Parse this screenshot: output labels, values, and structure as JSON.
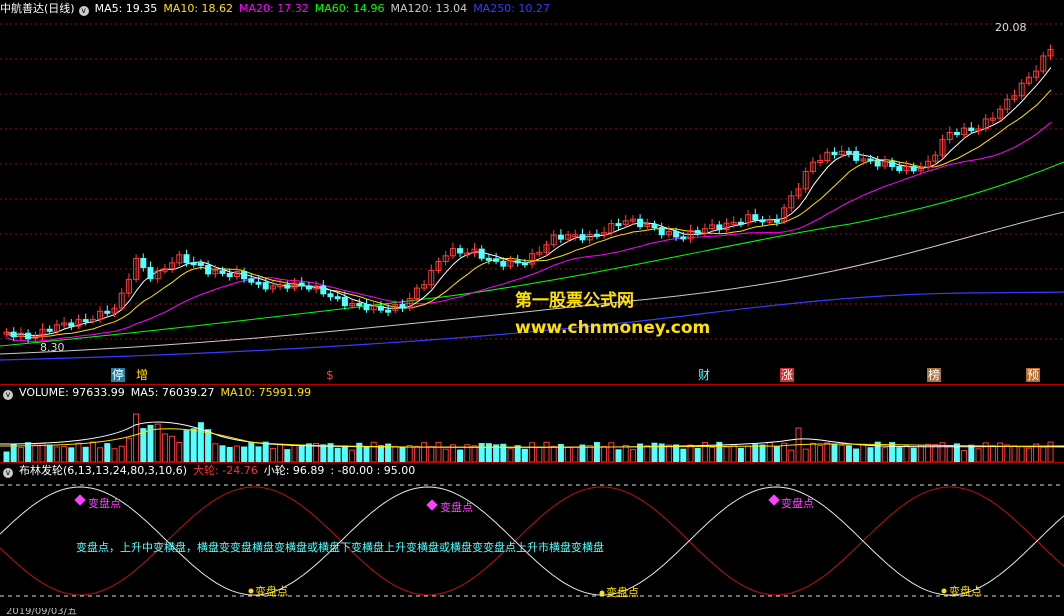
{
  "price_header": {
    "stock": "中航善达(日线)",
    "ma5": "MA5: 19.35",
    "ma10": "MA10: 18.62",
    "ma20": "MA20: 17.32",
    "ma60": "MA60: 14.96",
    "ma120": "MA120: 13.04",
    "ma250": "MA250: 10.27"
  },
  "price_labels": {
    "high": "20.08",
    "low": "8.30"
  },
  "events": [
    "停",
    "增",
    "$",
    "财",
    "涨",
    "榜",
    "预"
  ],
  "volume_header": {
    "vol": "VOLUME: 97633.99",
    "ma5": "MA5: 76039.27",
    "ma10": "MA10: 75991.99"
  },
  "ind_header": {
    "name": "布林发轮(6,13,13,24,80,3,10,6)",
    "big": "大轮: -24.76",
    "small": "小轮: 96.89",
    "range": ": -80.00 : 95.00"
  },
  "ind_labels": {
    "top1": "变盘点",
    "top2": "变盘点",
    "top3": "变盘点",
    "bot1": "变盘点",
    "bot2": "变盘点",
    "bot3": "变盘点",
    "text1": "变盘点，上升中变横盘，横盘变变盘",
    "text2": "横盘变横盘或横盘下变横盘上升",
    "text3": "变横盘或横盘变变盘点",
    "text4": "上升市横盘变横盘"
  },
  "date_label": "2019/09/03/五",
  "watermark": {
    "line1": "第一股票公式网",
    "line2": "www.chnmoney.com"
  },
  "colors": {
    "ma5": "#ffffff",
    "ma10": "#ffe000",
    "ma20": "#ff00ff",
    "ma60": "#00ff00",
    "ma120": "#cccccc",
    "ma250": "#3a3aff",
    "up": "#ff3a3a",
    "down": "#54ffff",
    "big": "#c01010",
    "small": "#e8e8e8"
  }
}
